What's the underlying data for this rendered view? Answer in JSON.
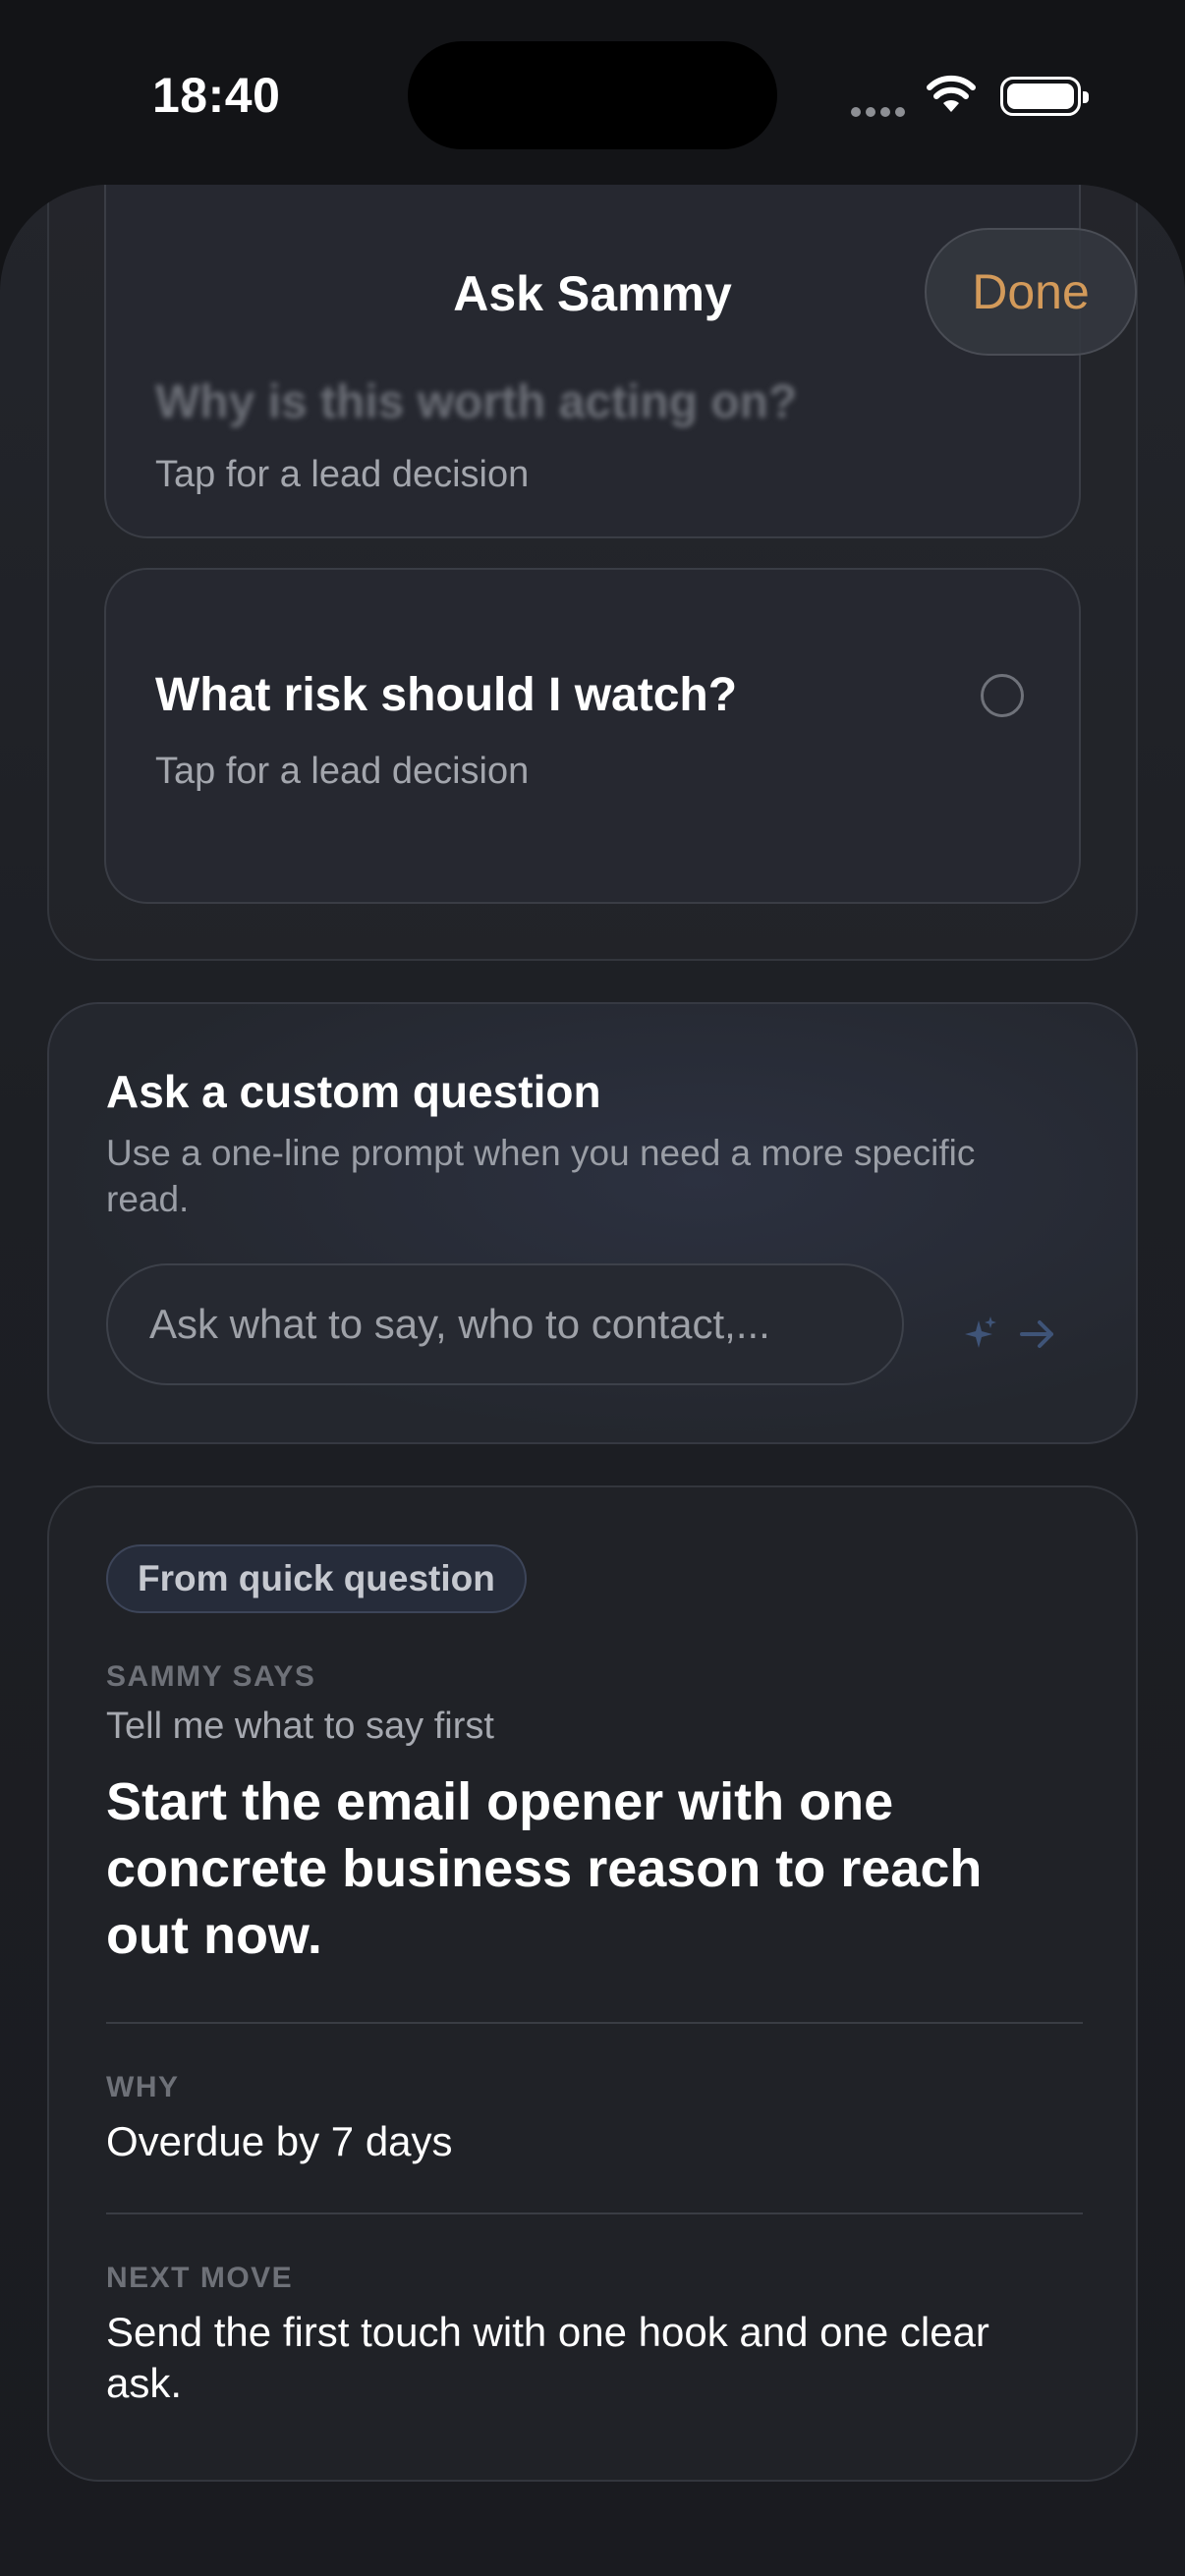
{
  "status_bar": {
    "time": "18:40"
  },
  "header": {
    "title": "Ask Sammy",
    "done_label": "Done",
    "done_color": "#d39a5a"
  },
  "quick_questions": [
    {
      "title": "Why is this worth acting on?",
      "subtitle": "Tap for a lead decision"
    },
    {
      "title": "What risk should I watch?",
      "subtitle": "Tap for a lead decision"
    }
  ],
  "custom_question": {
    "title": "Ask a custom question",
    "description": "Use a one-line prompt when you need a more specific read.",
    "placeholder": "Ask what to say, who to contact,..."
  },
  "answer": {
    "chip": "From quick question",
    "says_label": "SAMMY SAYS",
    "question": "Tell me what to say first",
    "text": "Start the email opener with one concrete business reason to reach out now.",
    "why_label": "WHY",
    "why_value": "Overdue by 7 days",
    "next_label": "NEXT MOVE",
    "next_value": "Send the first touch with one hook and one clear ask."
  }
}
